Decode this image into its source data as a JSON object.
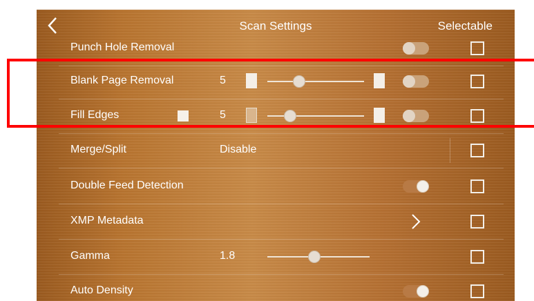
{
  "header": {
    "title": "Scan Settings",
    "right_label": "Selectable",
    "back_icon": "chevron-left-icon"
  },
  "rows": {
    "punch_hole": {
      "label": "Punch Hole Removal",
      "toggle_on": false
    },
    "blank_page": {
      "label": "Blank Page Removal",
      "value": "5",
      "slider_level": 0.3,
      "toggle_on": false
    },
    "fill_edges": {
      "label": "Fill Edges",
      "value": "5",
      "slider_level": 0.2,
      "toggle_on": false
    },
    "merge_split": {
      "label": "Merge/Split",
      "value": "Disable"
    },
    "double_feed": {
      "label": "Double Feed Detection",
      "toggle_on": true
    },
    "xmp_metadata": {
      "label": "XMP Metadata"
    },
    "gamma": {
      "label": "Gamma",
      "value": "1.8",
      "slider_level": 0.45
    },
    "auto_density": {
      "label": "Auto Density",
      "toggle_on": true
    }
  },
  "colors": {
    "highlight": "#ff0000",
    "wood_light": "#c88a47",
    "wood_dark": "#9a5a1f"
  }
}
